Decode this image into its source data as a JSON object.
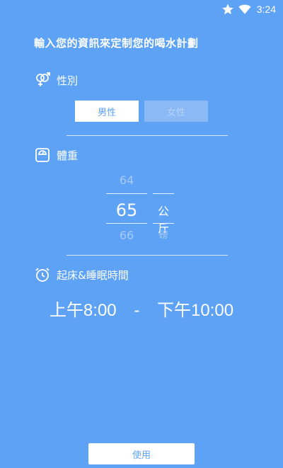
{
  "status_bar": {
    "time": "3:24",
    "icons": [
      "star-icon",
      "wifi-icon"
    ]
  },
  "heading": "輸入您的資訊來定制您的喝水計劃",
  "gender": {
    "label": "性別",
    "icon": "gender-icon",
    "options": [
      "男性",
      "女性"
    ],
    "selected": "男性"
  },
  "weight": {
    "label": "體重",
    "icon": "scale-icon",
    "prev_value": "64",
    "current_value": "65",
    "next_value": "66",
    "unit_current": "公斤",
    "unit_next": "磅"
  },
  "schedule": {
    "label": "起床&睡眠時間",
    "icon": "alarm-clock-icon",
    "wake_time": "上午8:00",
    "separator": "-",
    "sleep_time": "下午10:00"
  },
  "submit_label": "使用",
  "colors": {
    "background": "#5da2f4",
    "selected_button": "#ffffff",
    "unselected_button": "#8ab9f6"
  }
}
